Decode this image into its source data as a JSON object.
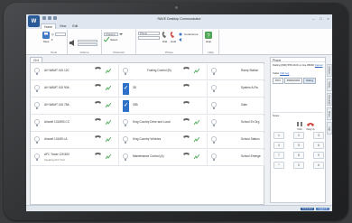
{
  "window": {
    "title": "RAVE Desktop Communicator",
    "app_logo": "W"
  },
  "tabs": [
    "Home",
    "View",
    "Edit"
  ],
  "ribbon": {
    "groups": [
      {
        "label": "Tools",
        "buttons": [
          "Save"
        ]
      },
      {
        "label": "Volume",
        "buttons": []
      },
      {
        "label": "Channels",
        "buttons": [
          "Select"
        ]
      },
      {
        "label": "Phone",
        "buttons": [
          "Dial",
          "Hold",
          "Conference"
        ]
      },
      {
        "label": "Help",
        "buttons": [
          "Help"
        ]
      }
    ],
    "channel_input": "Channel",
    "phone_input": "Phone"
  },
  "grid": {
    "tab_label": "Ch1",
    "rows": [
      {
        "c1": "AH WAMT 415 12C",
        "c2": "Fueling Control (B)",
        "c3": "Ramp Station"
      },
      {
        "c1": "AH WAMT 415 90A",
        "c2": "3D",
        "c3": "System A-Ra"
      },
      {
        "c1": "AH WAMT 415 78A",
        "c2": "30B",
        "c3": "Gate"
      },
      {
        "c1": "Aircraft 131/893 CC",
        "c2": "King Country Drive and Local",
        "c3": "School Ex Drg"
      },
      {
        "c1": "Aircraft 131/89 LA",
        "c2": "King Country Vehicles",
        "c3": "School Station"
      },
      {
        "c1": "AFC Tower 119.500",
        "c1_sub": "Speaking AFC Tunit",
        "c2": "Maintenance Control (A)",
        "c3": "School Emerge"
      }
    ],
    "checked_rows": [
      1,
      2
    ]
  },
  "panel": {
    "header": "Phone",
    "dialing_line": "Dialing (800) 555-0100 on line #8000",
    "dialing_link": "Cancel",
    "caller_label": "Caller",
    "caller_link": "Call Log",
    "line_buttons": [
      "6572",
      "6596623300",
      "Dialing"
    ],
    "notes_label": "Notes",
    "hangup_label": "Hang Up",
    "hold_label": "Hold",
    "keypad": [
      [
        "1",
        "2",
        "3"
      ],
      [
        "4",
        "5",
        "6"
      ],
      [
        "7",
        "8",
        "9"
      ],
      [
        "*",
        "0",
        "#"
      ]
    ]
  },
  "side_tabs": [
    "Contacts",
    "History",
    "Voicemail",
    "Phone",
    "Help"
  ],
  "status": {
    "left": "",
    "chip1": "Connected",
    "chip2": "Logged In"
  },
  "colors": {
    "accent": "#2f71c9",
    "brand": "#2b5a99",
    "hangup": "#d04b45",
    "active_green": "#3aa445"
  }
}
